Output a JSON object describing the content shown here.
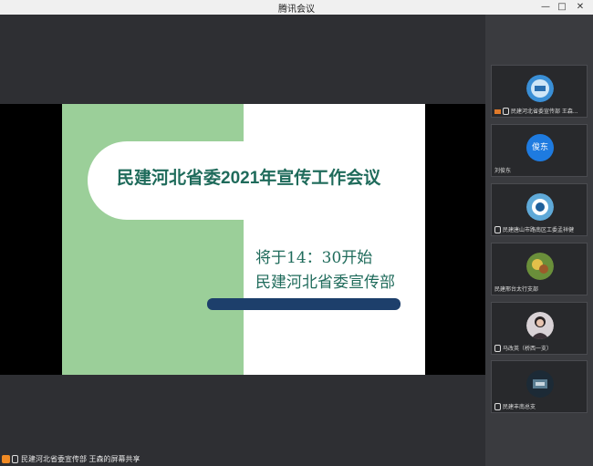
{
  "window": {
    "title": "腾讯会议",
    "controls": [
      "—",
      "□",
      "✕"
    ]
  },
  "slide": {
    "title_part1": "民建河北省委",
    "title_year": "2021",
    "title_part2": "年宣传工作会议",
    "time": "将于14：30开始",
    "org": "民建河北省委宣传部"
  },
  "participants": [
    {
      "label": "民建河北省委宣传部 王森...",
      "avatar_text": ""
    },
    {
      "label": "刘俊东",
      "avatar_text": "俊东"
    },
    {
      "label": "民建唐山市路南区工委孟祥健",
      "avatar_text": ""
    },
    {
      "label": "民建邢台太行支部",
      "avatar_text": ""
    },
    {
      "label": "马改英（桥西一支）",
      "avatar_text": ""
    },
    {
      "label": "民建丰南总支",
      "avatar_text": ""
    }
  ],
  "bottom_status": "民建河北省委宣传部 王森的屏幕共享",
  "colors": {
    "slide_green": "#9bcf99",
    "slide_text": "#1f6b5b",
    "slide_bar": "#1d3f6b"
  }
}
